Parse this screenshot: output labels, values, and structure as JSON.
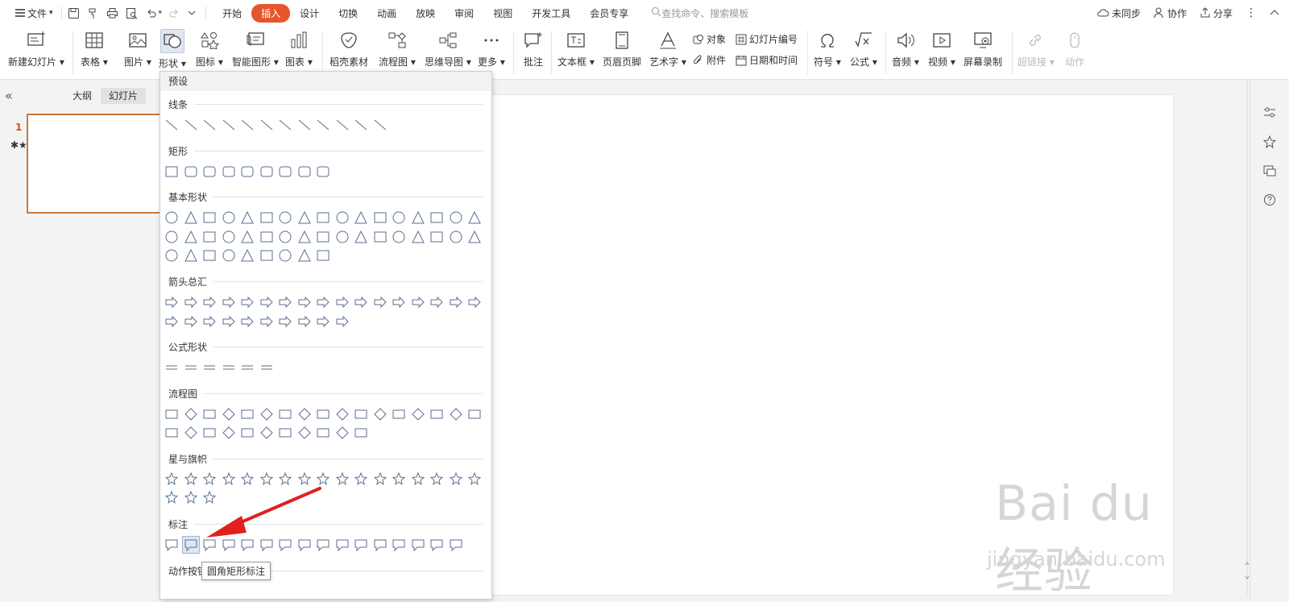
{
  "topbar": {
    "file_menu": "文件",
    "tabs": [
      "开始",
      "插入",
      "设计",
      "切换",
      "动画",
      "放映",
      "审阅",
      "视图",
      "开发工具",
      "会员专享"
    ],
    "active_tab": "插入",
    "search_placeholder": "查找命令、搜索模板",
    "sync": "未同步",
    "collab": "协作",
    "share": "分享"
  },
  "ribbon": {
    "new_slide": "新建幻灯片",
    "table": "表格",
    "picture": "图片",
    "shape": "形状",
    "icon": "图标",
    "smartart": "智能图形",
    "chart": "图表",
    "material": "稻壳素材",
    "flowchart": "流程图",
    "mindmap": "思维导图",
    "more": "更多",
    "comment": "批注",
    "textbox": "文本框",
    "header_footer": "页眉页脚",
    "wordart": "艺术字",
    "object": "对象",
    "slide_number": "幻灯片编号",
    "attachment": "附件",
    "datetime": "日期和时间",
    "symbol": "符号",
    "formula": "公式",
    "audio": "音频",
    "video": "视频",
    "screen_record": "屏幕录制",
    "hyperlink": "超链接",
    "action": "动作"
  },
  "leftpanel": {
    "tab_outline": "大纲",
    "tab_slides": "幻灯片",
    "slide_number": "1"
  },
  "dropdown": {
    "header": "预设",
    "categories": {
      "lines": "线条",
      "rectangles": "矩形",
      "basic": "基本形状",
      "arrows": "箭头总汇",
      "equation": "公式形状",
      "flowchart": "流程图",
      "stars": "星与旗帜",
      "callouts": "标注",
      "action_buttons": "动作按钮"
    }
  },
  "tooltip": "圆角矩形标注",
  "watermark": {
    "brand": "Bai du 经验",
    "url": "jingyan.baidu.com"
  },
  "colors": {
    "accent": "#e8552d",
    "shape_stroke": "#5a6f8f",
    "arrow": "#e0201c"
  }
}
